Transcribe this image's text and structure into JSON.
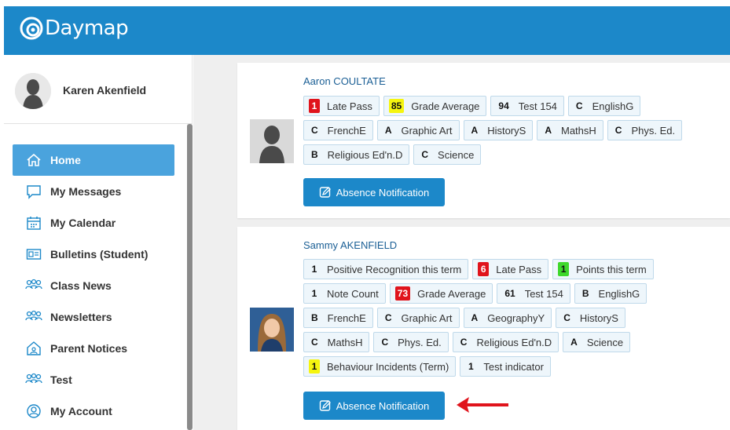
{
  "app": {
    "logo_text": "Daymap",
    "brand_color": "#1c88c9"
  },
  "user": {
    "name": "Karen Akenfield"
  },
  "nav": [
    {
      "label": "Home",
      "icon": "home-icon",
      "active": true
    },
    {
      "label": "My Messages",
      "icon": "message-icon"
    },
    {
      "label": "My Calendar",
      "icon": "calendar-icon"
    },
    {
      "label": "Bulletins (Student)",
      "icon": "bulletin-icon"
    },
    {
      "label": "Class News",
      "icon": "people-icon"
    },
    {
      "label": "Newsletters",
      "icon": "people-icon"
    },
    {
      "label": "Parent Notices",
      "icon": "house-icon"
    },
    {
      "label": "Test",
      "icon": "people-icon"
    },
    {
      "label": "My Account",
      "icon": "account-icon"
    }
  ],
  "students": [
    {
      "name": "Aaron COULTATE",
      "rows": [
        [
          {
            "badge": "1",
            "color": "red",
            "label": "Late Pass"
          },
          {
            "badge": "85",
            "color": "yellow",
            "label": "Grade Average"
          },
          {
            "badge": "94",
            "color": "none",
            "label": "Test 154"
          },
          {
            "badge": "C",
            "color": "none",
            "label": "EnglishG"
          }
        ],
        [
          {
            "badge": "C",
            "color": "none",
            "label": "FrenchE"
          },
          {
            "badge": "A",
            "color": "none",
            "label": "Graphic Art"
          },
          {
            "badge": "A",
            "color": "none",
            "label": "HistoryS"
          },
          {
            "badge": "A",
            "color": "none",
            "label": "MathsH"
          },
          {
            "badge": "C",
            "color": "none",
            "label": "Phys. Ed."
          }
        ],
        [
          {
            "badge": "B",
            "color": "none",
            "label": "Religious Ed'n.D"
          },
          {
            "badge": "C",
            "color": "none",
            "label": "Science"
          }
        ]
      ],
      "button": "Absence Notification"
    },
    {
      "name": "Sammy AKENFIELD",
      "rows": [
        [
          {
            "badge": "1",
            "color": "none",
            "label": "Positive Recognition this term"
          },
          {
            "badge": "6",
            "color": "red",
            "label": "Late Pass"
          },
          {
            "badge": "1",
            "color": "green",
            "label": "Points this term"
          }
        ],
        [
          {
            "badge": "1",
            "color": "none",
            "label": "Note Count"
          },
          {
            "badge": "73",
            "color": "red",
            "label": "Grade Average"
          },
          {
            "badge": "61",
            "color": "none",
            "label": "Test 154"
          },
          {
            "badge": "B",
            "color": "none",
            "label": "EnglishG"
          }
        ],
        [
          {
            "badge": "B",
            "color": "none",
            "label": "FrenchE"
          },
          {
            "badge": "C",
            "color": "none",
            "label": "Graphic Art"
          },
          {
            "badge": "A",
            "color": "none",
            "label": "GeographyY"
          },
          {
            "badge": "C",
            "color": "none",
            "label": "HistoryS"
          }
        ],
        [
          {
            "badge": "C",
            "color": "none",
            "label": "MathsH"
          },
          {
            "badge": "C",
            "color": "none",
            "label": "Phys. Ed."
          },
          {
            "badge": "C",
            "color": "none",
            "label": "Religious Ed'n.D"
          },
          {
            "badge": "A",
            "color": "none",
            "label": "Science"
          }
        ],
        [
          {
            "badge": "1",
            "color": "yellow",
            "label": "Behaviour Incidents (Term)"
          },
          {
            "badge": "1",
            "color": "none",
            "label": "Test indicator"
          }
        ]
      ],
      "button": "Absence Notification"
    }
  ]
}
